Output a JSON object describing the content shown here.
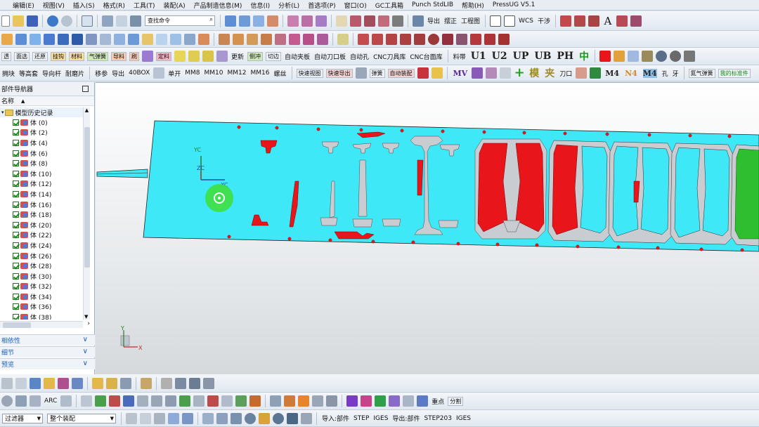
{
  "app_title": "PressUG V5.1",
  "menu": [
    "编辑(E)",
    "视图(V)",
    "插入(S)",
    "格式(R)",
    "工具(T)",
    "装配(A)",
    "产品制造信息(M)",
    "信息(I)",
    "分析(L)",
    "首选项(P)",
    "窗口(O)",
    "GC工具箱",
    "Punch StdLIB",
    "帮助(H)"
  ],
  "toolbar1": {
    "search_placeholder": "查找命令",
    "labels": [
      "导出",
      "摆正",
      "工程图",
      "WCS",
      "干涉"
    ]
  },
  "toolbar3": {
    "small_labels": [
      "透",
      "面选",
      "还原",
      "挂钩",
      "材料",
      "气弹簧",
      "导料",
      "刷",
      "定料",
      "更新",
      "侧冲",
      "切边"
    ],
    "labels": [
      "自动夹板",
      "自动刀口板",
      "自动孔",
      "CNC刀具库",
      "CNC台面库",
      "料带"
    ],
    "big_labels": [
      "U1",
      "U2",
      "UP",
      "UB",
      "PH",
      "中"
    ]
  },
  "toolbar4": {
    "labels": [
      "拥块",
      "等高套",
      "导向杆",
      "耐磨片",
      "移参",
      "导出",
      "40BOX",
      "单开",
      "MM8",
      "MM10",
      "MM12",
      "MM16",
      "螺丝"
    ],
    "small_labels": [
      "快速视图",
      "快速导出",
      "弹簧",
      "自动装配"
    ],
    "big_labels": [
      "MV",
      "模",
      "夹",
      "M4",
      "N4",
      "M4"
    ],
    "right_labels": [
      "刀口",
      "孔",
      "牙",
      "氮气弹簧",
      "我的标准件"
    ]
  },
  "navigator": {
    "title": "部件导航器",
    "column_header": "名称",
    "root": "模型历史记录",
    "items": [
      "体 (0)",
      "体 (2)",
      "体 (4)",
      "体 (6)",
      "体 (8)",
      "体 (10)",
      "体 (12)",
      "体 (14)",
      "体 (16)",
      "体 (18)",
      "体 (20)",
      "体 (22)",
      "体 (24)",
      "体 (26)",
      "体 (28)",
      "体 (30)",
      "体 (32)",
      "体 (34)",
      "体 (36)",
      "体 (38)"
    ],
    "panels": [
      "相依性",
      "细节",
      "预览"
    ]
  },
  "viewport": {
    "wcs_labels": [
      "YC",
      "ZC",
      "XC"
    ],
    "triad_labels": [
      "Y",
      "X"
    ],
    "colors": {
      "strip": "#3ee8f7",
      "punch_red": "#e8151b",
      "cut_grey": "#c9cdd2",
      "green": "#2fbe2f"
    }
  },
  "bottom": {
    "labels": [
      "ARC",
      "重点",
      "分割"
    ],
    "filter_label": "过滤器",
    "assembly_label": "整个装配",
    "io_labels": [
      "导入:部件",
      "STEP",
      "IGES",
      "导出:部件",
      "STEP203",
      "IGES"
    ]
  }
}
